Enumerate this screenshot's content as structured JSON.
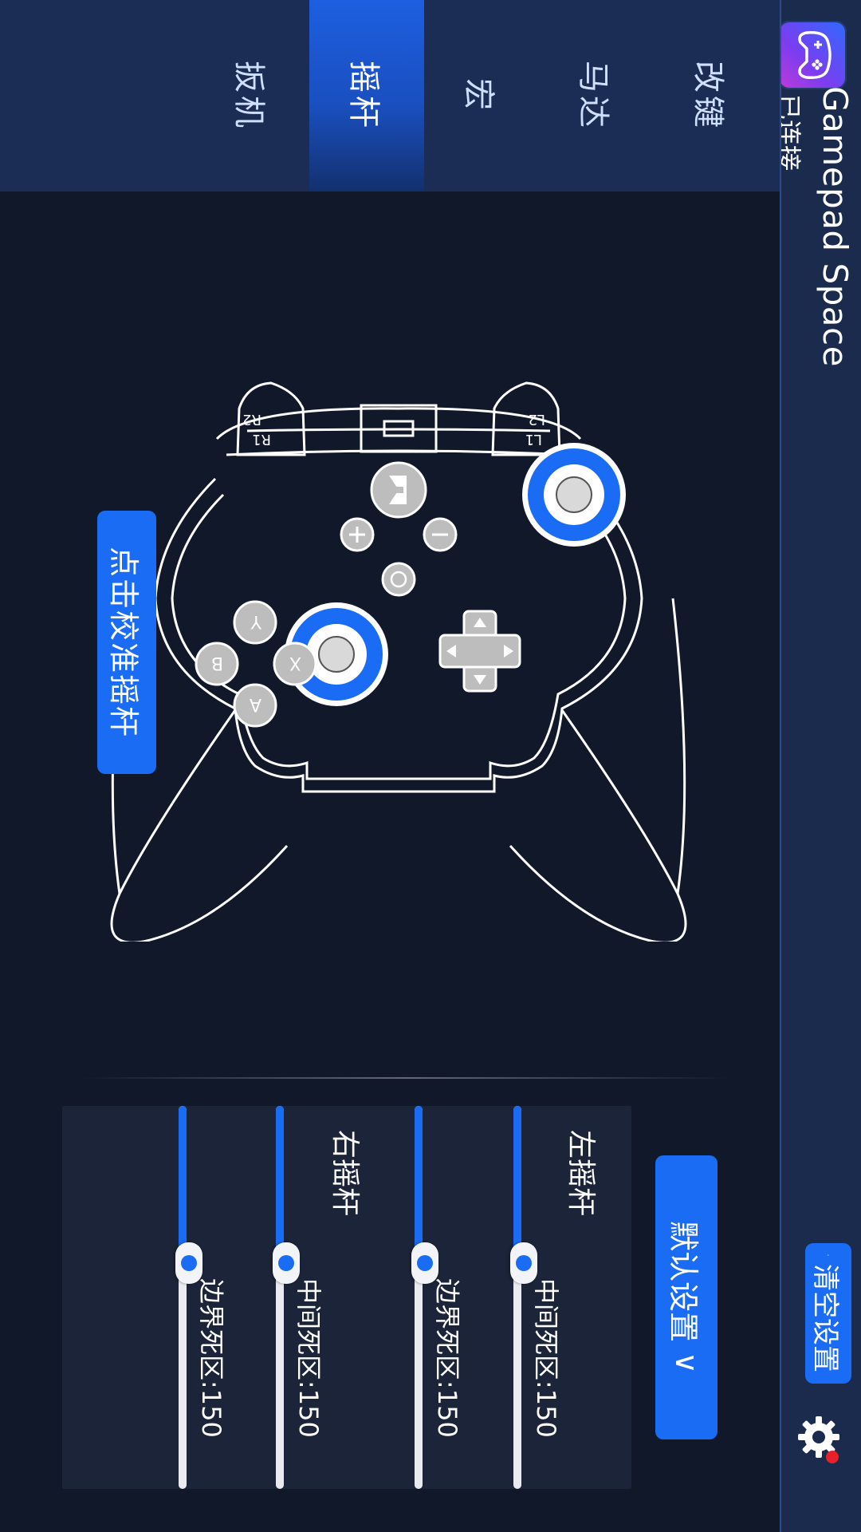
{
  "app": {
    "title": "Gamepad Space",
    "status": "已连接"
  },
  "header": {
    "clear_label": "清空设置"
  },
  "tabs": [
    {
      "label": "改键",
      "active": false
    },
    {
      "label": "马达",
      "active": false
    },
    {
      "label": "宏",
      "active": false
    },
    {
      "label": "摇杆",
      "active": true
    },
    {
      "label": "扳机",
      "active": false
    }
  ],
  "controller": {
    "labels": {
      "L1": "L1",
      "L2": "L2",
      "R1": "R1",
      "R2": "R2"
    },
    "face_buttons": {
      "y": "Y",
      "x": "X",
      "b": "B",
      "a": "A"
    },
    "calibrate_label": "点击校准摇杆"
  },
  "settings": {
    "preset_label": "默认设置",
    "preset_chevron": "∨",
    "left_stick": {
      "title": "左摇杆",
      "sliders": [
        {
          "label": "中间死区:150",
          "value": 150,
          "fill": 0.41
        },
        {
          "label": "边界死区:150",
          "value": 150,
          "fill": 0.41
        }
      ]
    },
    "right_stick": {
      "title": "右摇杆",
      "sliders": [
        {
          "label": "中间死区:150",
          "value": 150,
          "fill": 0.41
        },
        {
          "label": "边界死区:150",
          "value": 150,
          "fill": 0.41
        }
      ]
    }
  },
  "colors": {
    "accent": "#1a6cf5",
    "header": "#1a2b4d",
    "background": "#10182a",
    "alert_dot": "#e8202a"
  },
  "icons": {
    "app": "gamepad-icon",
    "clear": "broom-icon",
    "settings": "gear-icon"
  }
}
